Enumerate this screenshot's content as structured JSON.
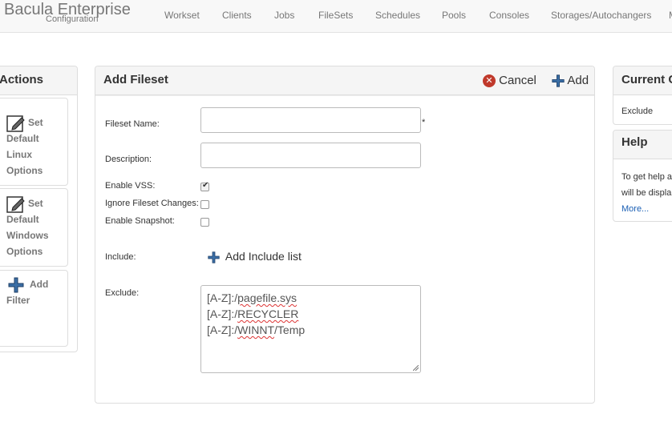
{
  "header": {
    "brand_title": "Bacula Enterprise",
    "brand_subtitle": "Configuration",
    "nav": [
      "Workset",
      "Clients",
      "Jobs",
      "FileSets",
      "Schedules",
      "Pools",
      "Consoles",
      "Storages/Autochangers",
      "M"
    ]
  },
  "actions": {
    "title": "Actions",
    "items": [
      {
        "lines": [
          "Set",
          "Default",
          "Linux",
          "Options"
        ],
        "icon": "edit-icon"
      },
      {
        "lines": [
          "Set",
          "Default",
          "Windows",
          "Options"
        ],
        "icon": "edit-icon"
      },
      {
        "lines": [
          "Add",
          "Filter"
        ],
        "icon": "plus-icon"
      }
    ]
  },
  "form": {
    "title": "Add Fileset",
    "cancel_label": "Cancel",
    "add_label": "Add",
    "fileset_name_label": "Fileset Name:",
    "fileset_name_value": "",
    "required_mark": "*",
    "description_label": "Description:",
    "description_value": "",
    "enable_vss_label": "Enable VSS:",
    "enable_vss_checked": true,
    "ignore_changes_label": "Ignore Fileset Changes:",
    "ignore_changes_checked": false,
    "enable_snapshot_label": "Enable Snapshot:",
    "enable_snapshot_checked": false,
    "include_label": "Include:",
    "add_include_label": "Add Include list",
    "exclude_label": "Exclude:",
    "exclude_lines": [
      {
        "prefix": "[A-Z]:/",
        "word": "pagefile.sys",
        "suffix": ""
      },
      {
        "prefix": "[A-Z]:/",
        "word": "RECYCLER",
        "suffix": ""
      },
      {
        "prefix": "[A-Z]:/",
        "word": "WINNT",
        "suffix": "/Temp"
      }
    ]
  },
  "current": {
    "title": "Current C",
    "item": "Exclude"
  },
  "help": {
    "title": "Help",
    "line1": "To get help a",
    "line2": "will be displa",
    "more": "More..."
  }
}
